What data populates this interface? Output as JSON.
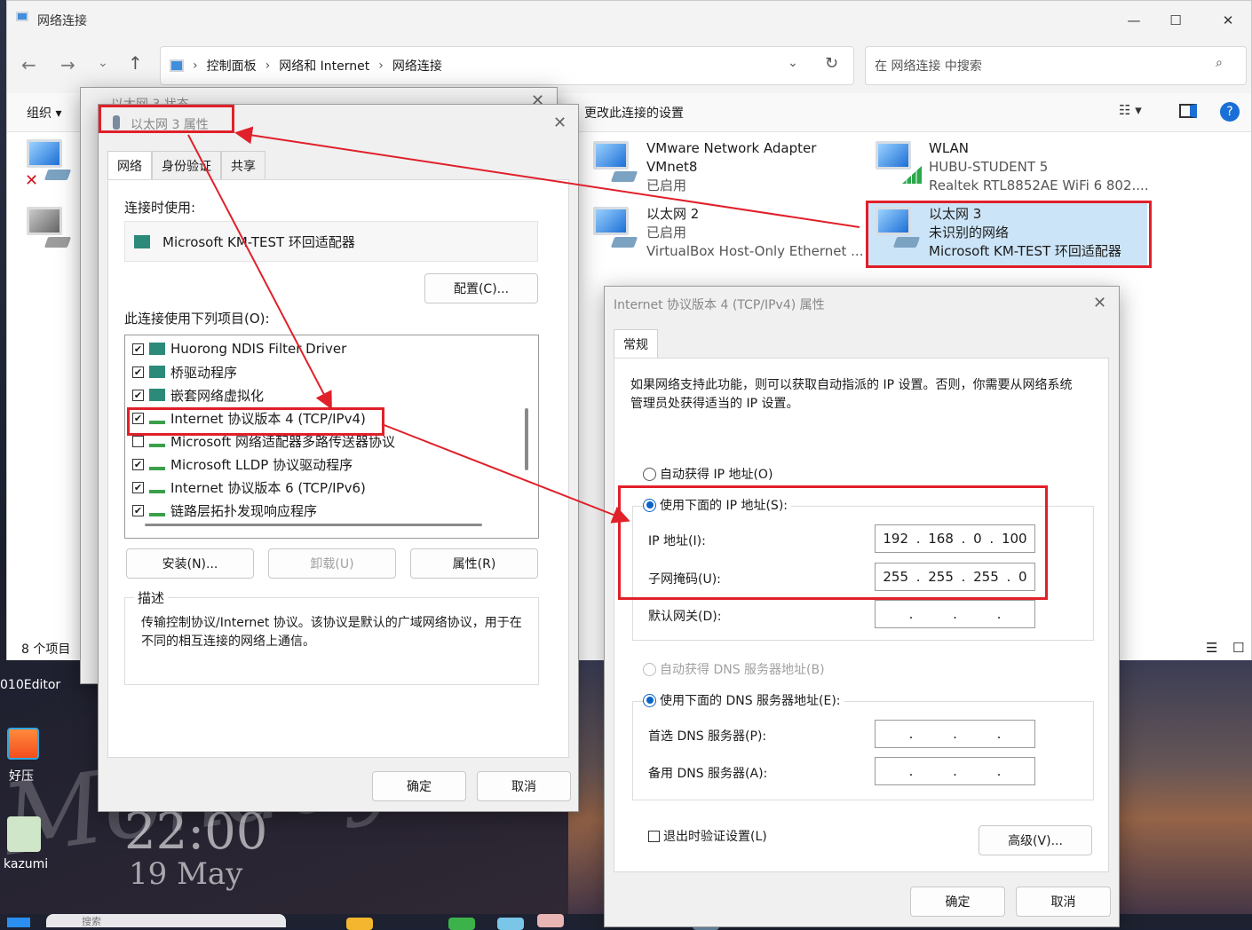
{
  "explorer": {
    "title": "网络连接",
    "breadcrumb": [
      "控制面板",
      "网络和 Internet",
      "网络连接"
    ],
    "search_placeholder": "在 网络连接 中搜索",
    "organize": "组织",
    "change_settings": "更改此连接的设置",
    "status": "8 个项目",
    "adapters": [
      {
        "name": "VMware Network Adapter VMnet8",
        "line1": "VMware Network Adapter",
        "line2": "VMnet8",
        "line3": "已启用"
      },
      {
        "name": "WLAN",
        "line1": "WLAN",
        "line2": "HUBU-STUDENT 5",
        "line3": "Realtek RTL8852AE WiFi 6 802...."
      },
      {
        "name": "以太网 2",
        "line1": "以太网 2",
        "line2": "已启用",
        "line3": "VirtualBox Host-Only Ethernet ..."
      },
      {
        "name": "以太网 3",
        "line1": "以太网 3",
        "line2": "未识别的网络",
        "line3": "Microsoft KM-TEST 环回适配器"
      }
    ]
  },
  "status_dialog": {
    "title": "以太网 3 状态"
  },
  "props_dialog": {
    "title": "以太网 3 属性",
    "tabs": [
      "网络",
      "身份验证",
      "共享"
    ],
    "connect_using_label": "连接时使用:",
    "adapter_name": "Microsoft KM-TEST 环回适配器",
    "configure": "配置(C)...",
    "items_label": "此连接使用下列项目(O):",
    "items": [
      {
        "label": "Huorong NDIS Filter Driver",
        "checked": true
      },
      {
        "label": "桥驱动程序",
        "checked": true
      },
      {
        "label": "嵌套网络虚拟化",
        "checked": true
      },
      {
        "label": "Internet 协议版本 4 (TCP/IPv4)",
        "checked": true
      },
      {
        "label": "Microsoft 网络适配器多路传送器协议",
        "checked": false
      },
      {
        "label": "Microsoft LLDP 协议驱动程序",
        "checked": true
      },
      {
        "label": "Internet 协议版本 6 (TCP/IPv6)",
        "checked": true
      },
      {
        "label": "链路层拓扑发现响应程序",
        "checked": true
      }
    ],
    "install": "安装(N)...",
    "uninstall": "卸载(U)",
    "properties": "属性(R)",
    "desc_label": "描述",
    "desc_text": "传输控制协议/Internet 协议。该协议是默认的广域网络协议，用于在不同的相互连接的网络上通信。",
    "ok": "确定",
    "cancel": "取消"
  },
  "ipv4_dialog": {
    "title": "Internet 协议版本 4 (TCP/IPv4) 属性",
    "tab": "常规",
    "intro": "如果网络支持此功能，则可以获取自动指派的 IP 设置。否则，你需要从网络系统管理员处获得适当的 IP 设置。",
    "auto_ip": "自动获得 IP 地址(O)",
    "manual_ip": "使用下面的 IP 地址(S):",
    "ip_label": "IP 地址(I):",
    "ip": [
      "192",
      "168",
      "0",
      "100"
    ],
    "mask_label": "子网掩码(U):",
    "mask": [
      "255",
      "255",
      "255",
      "0"
    ],
    "gateway_label": "默认网关(D):",
    "auto_dns": "自动获得 DNS 服务器地址(B)",
    "manual_dns": "使用下面的 DNS 服务器地址(E):",
    "dns1_label": "首选 DNS 服务器(P):",
    "dns2_label": "备用 DNS 服务器(A):",
    "validate": "退出时验证设置(L)",
    "advanced": "高级(V)...",
    "ok": "确定",
    "cancel": "取消"
  },
  "desktop": {
    "icons": [
      {
        "label": "010Editor"
      },
      {
        "label": "好压"
      },
      {
        "label": "kazumi"
      }
    ],
    "clock_time": "22:00",
    "clock_date": "19 May",
    "wallpaper_text": "Monday",
    "taskbar_search": "搜索"
  },
  "colors": {
    "highlight": "#e0202a",
    "accent": "#0a64c8"
  }
}
